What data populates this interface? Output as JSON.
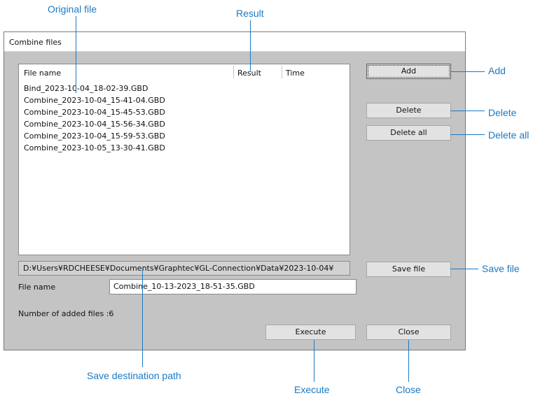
{
  "callouts": {
    "original_file": "Original file",
    "result": "Result",
    "add": "Add",
    "delete": "Delete",
    "delete_all": "Delete all",
    "save_file": "Save file",
    "save_destination_path": "Save destination path",
    "execute": "Execute",
    "close": "Close"
  },
  "dialog": {
    "title": "Combine files",
    "columns": {
      "file_name": "File name",
      "result": "Result",
      "time": "Time"
    },
    "files": [
      "Bind_2023-10-04_18-02-39.GBD",
      "Combine_2023-10-04_15-41-04.GBD",
      "Combine_2023-10-04_15-45-53.GBD",
      "Combine_2023-10-04_15-56-34.GBD",
      "Combine_2023-10-04_15-59-53.GBD",
      "Combine_2023-10-05_13-30-41.GBD"
    ],
    "buttons": {
      "add": "Add",
      "delete": "Delete",
      "delete_all": "Delete all",
      "save_file": "Save file",
      "execute": "Execute",
      "close": "Close"
    },
    "save_path": "D:¥Users¥RDCHEESE¥Documents¥Graphtec¥GL-Connection¥Data¥2023-10-04¥",
    "file_name_label": "File name",
    "file_name_value": "Combine_10-13-2023_18-51-35.GBD",
    "added_count_text": "Number of added files :6"
  }
}
